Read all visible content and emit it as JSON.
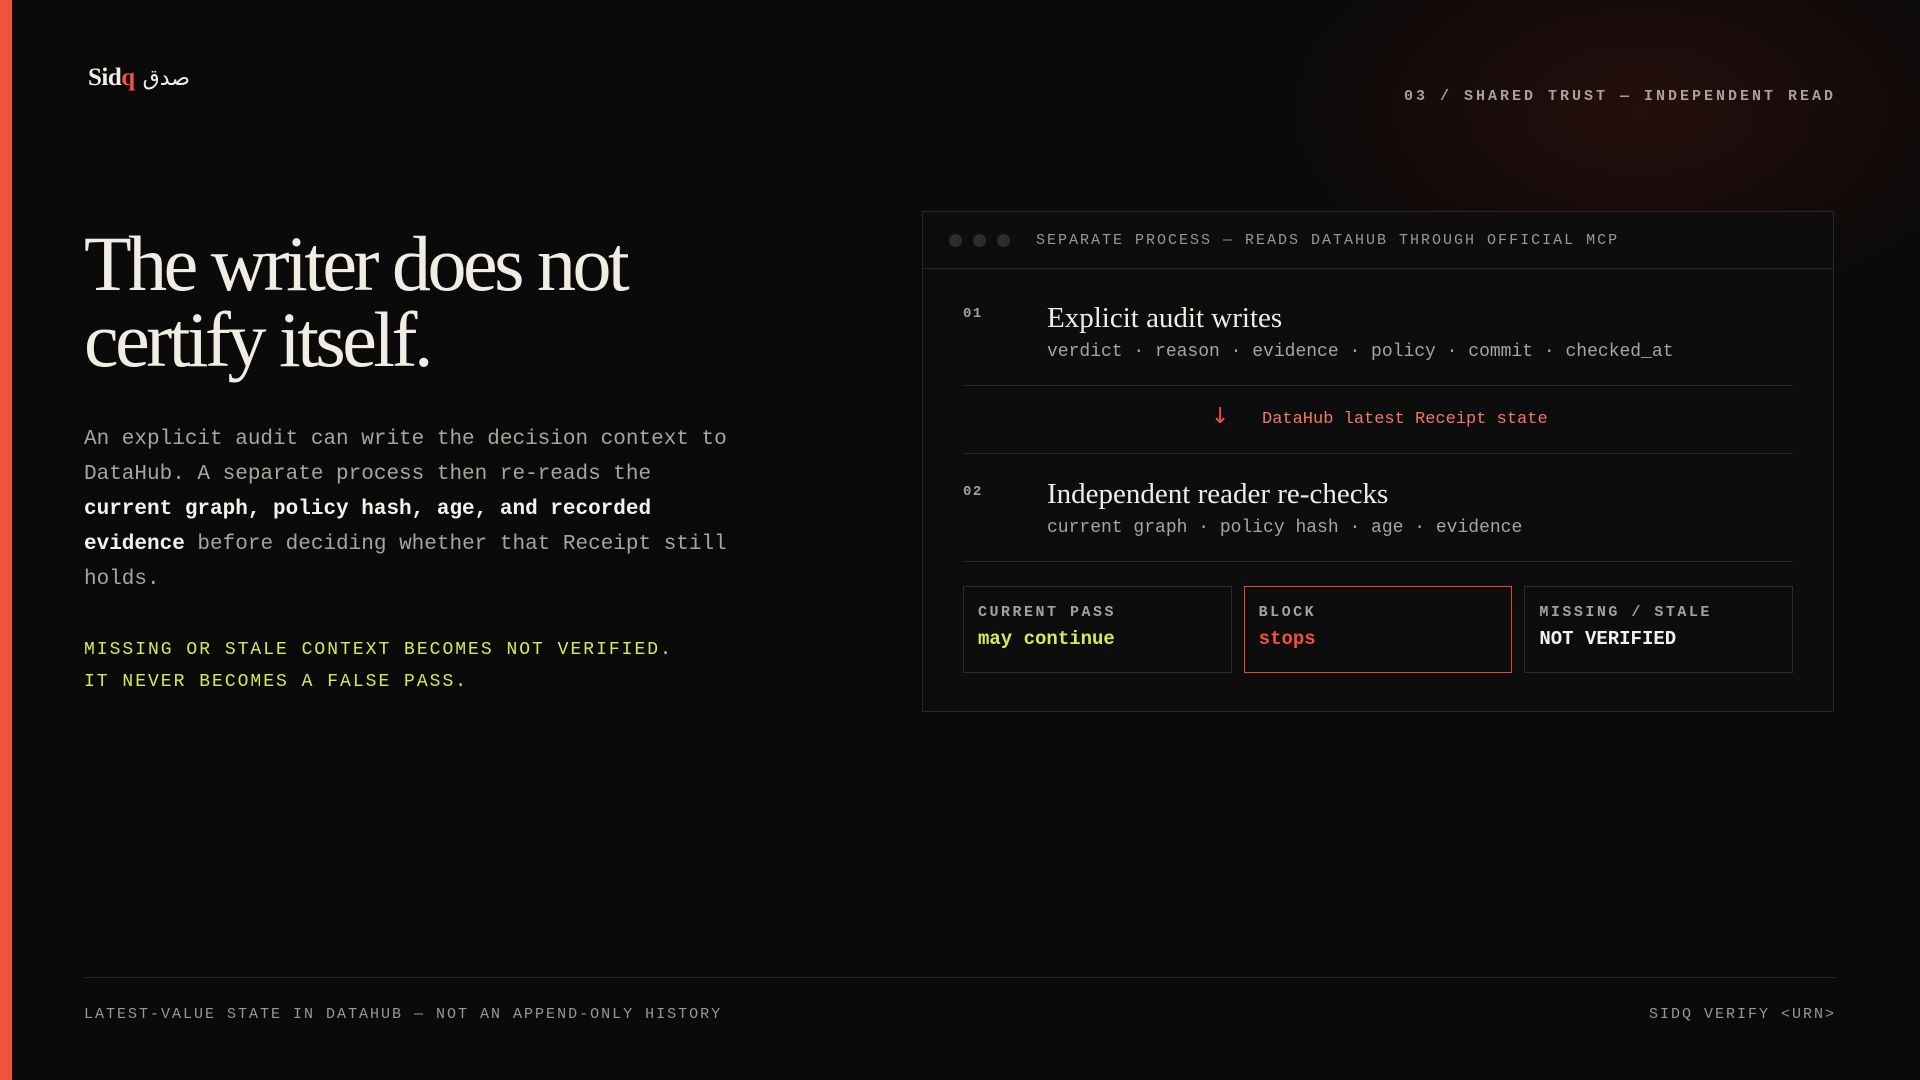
{
  "brand": {
    "name_latin_prefix": "Sid",
    "name_latin_suffix": "q",
    "name_arabic": "صدق",
    "accent_color": "#f2513c"
  },
  "header": {
    "section_label": "03 / SHARED TRUST — INDEPENDENT READ"
  },
  "hero": {
    "headline_line1": "The writer does not",
    "headline_line2": "certify itself.",
    "body_part1": "An explicit audit can write the decision context to DataHub. A separate process then re-reads the ",
    "body_bold": "current graph, policy hash, age, and recorded evidence",
    "body_part2": " before deciding whether that Receipt still holds.",
    "warning_line1": "MISSING OR STALE CONTEXT BECOMES NOT VERIFIED.",
    "warning_line2": "IT NEVER BECOMES A FALSE PASS.",
    "warning_color": "#d4ec54"
  },
  "panel": {
    "title": "SEPARATE PROCESS — READS DATAHUB THROUGH OFFICIAL MCP",
    "window_dots": [
      "dot",
      "dot",
      "dot"
    ],
    "steps": [
      {
        "num": "01",
        "title": "Explicit audit writes",
        "sub": "verdict · reason · evidence · policy · commit · checked_at"
      },
      {
        "num": "02",
        "title": "Independent reader re-checks",
        "sub": "current graph · policy hash · age · evidence"
      }
    ],
    "flow": {
      "arrow_icon": "arrow-down-icon",
      "arrow_glyph": "↓",
      "label": "DataHub latest Receipt state"
    },
    "results": [
      {
        "label": "CURRENT PASS",
        "value": "may continue",
        "color": "#d4ec54"
      },
      {
        "label": "BLOCK",
        "value": "stops",
        "color": "#f2513c"
      },
      {
        "label": "MISSING / STALE",
        "value": "NOT VERIFIED",
        "color": "#f4f1ea"
      }
    ]
  },
  "footer": {
    "left": "LATEST-VALUE STATE IN DATAHUB — NOT AN APPEND-ONLY HISTORY",
    "right": "SIDQ VERIFY <URN>"
  }
}
